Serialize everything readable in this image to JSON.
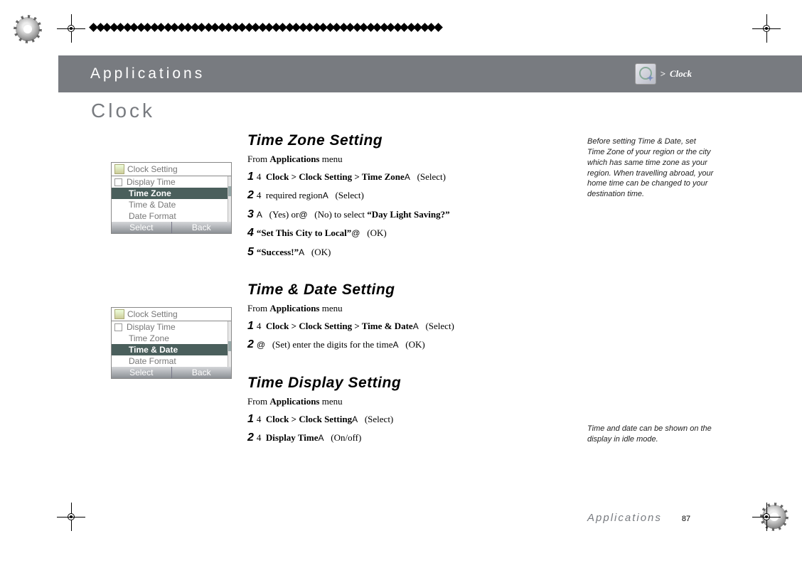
{
  "header": {
    "title": "Applications",
    "breadcrumb_prefix": ">",
    "breadcrumb": "Clock"
  },
  "page_title": "Clock",
  "diamond_count": 52,
  "phone1": {
    "title": "Clock Setting",
    "items": [
      "Display Time",
      "Time Zone",
      "Time & Date",
      "Date Format"
    ],
    "selected_index": 1,
    "soft_left": "Select",
    "soft_right": "Back"
  },
  "phone2": {
    "title": "Clock Setting",
    "items": [
      "Display Time",
      "Time Zone",
      "Time & Date",
      "Date Format"
    ],
    "selected_index": 2,
    "soft_left": "Select",
    "soft_right": "Back"
  },
  "sections": [
    {
      "heading": "Time Zone Setting",
      "from_prefix": "From ",
      "from_menu": "Applications",
      "from_suffix": " menu",
      "steps": [
        {
          "n": "1",
          "html": "4&nbsp;&nbsp;<b>Clock &gt; Clock Setting &gt; Time Zone</b><span class='nav'>A</span>&nbsp;&nbsp;&nbsp;(Select)"
        },
        {
          "n": "2",
          "html": "4&nbsp;&nbsp;required region<span class='nav'>A</span>&nbsp;&nbsp;&nbsp;(Select)"
        },
        {
          "n": "3",
          "html": "<span class='nav'>A</span>&nbsp;&nbsp;&nbsp;(Yes) or<span class='nav'>@</span>&nbsp;&nbsp;&nbsp;(No) to select <b>&ldquo;Day Light Saving?&rdquo;</b>"
        },
        {
          "n": "4",
          "html": "<b>&ldquo;Set This City to Local&rdquo;</b><span class='nav'>@</span>&nbsp;&nbsp;&nbsp;(OK)"
        },
        {
          "n": "5",
          "html": "<b>&ldquo;Success!&rdquo;</b><span class='nav'>A</span>&nbsp;&nbsp;&nbsp;(OK)"
        }
      ]
    },
    {
      "heading": "Time & Date Setting",
      "from_prefix": "From ",
      "from_menu": "Applications",
      "from_suffix": " menu",
      "steps": [
        {
          "n": "1",
          "html": "4&nbsp;&nbsp;<b>Clock &gt; Clock Setting &gt; Time &amp; Date</b><span class='nav'>A</span>&nbsp;&nbsp;&nbsp;(Select)"
        },
        {
          "n": "2",
          "html": "<span class='nav'>@</span>&nbsp;&nbsp;&nbsp;(Set) enter the digits for the time<span class='nav'>A</span>&nbsp;&nbsp;&nbsp;(OK)"
        }
      ]
    },
    {
      "heading": "Time Display Setting",
      "from_prefix": "From ",
      "from_menu": "Applications",
      "from_suffix": " menu",
      "steps": [
        {
          "n": "1",
          "html": "4&nbsp;&nbsp;<b>Clock &gt; Clock Setting</b><span class='nav'>A</span>&nbsp;&nbsp;&nbsp;(Select)"
        },
        {
          "n": "2",
          "html": "4&nbsp;&nbsp;<b>Display Time</b><span class='nav'>A</span>&nbsp;&nbsp;&nbsp;(On/off)"
        }
      ]
    }
  ],
  "sidenotes": {
    "sn1": "Before setting Time & Date, set Time Zone of your region or the city which has same time zone as your region. When travelling abroad, your home time can be changed to your destination time.",
    "sn2": "Time and date can be shown on the display in idle mode."
  },
  "footer": {
    "label": "Applications",
    "page": "87"
  }
}
